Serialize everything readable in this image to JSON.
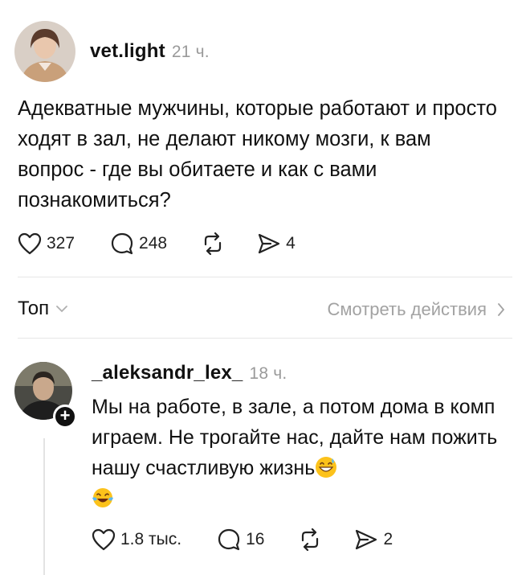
{
  "post": {
    "author": "vet.light",
    "time": "21 ч.",
    "text": "Адекватные мужчины, которые работают и просто ходят в зал, не делают никому мозги, к вам вопрос - где вы обитаете и как с вами познакомиться?",
    "likes": "327",
    "comments": "248",
    "shares": "4"
  },
  "sort": {
    "label": "Топ",
    "see_actions": "Смотреть действия"
  },
  "reply": {
    "author": "_aleksandr_lex_",
    "time": "18 ч.",
    "text": "Мы на работе, в зале, а потом дома в комп играем. Не трогайте нас, дайте нам пожить нашу счастливую жизнь",
    "emojis": [
      "grinning-sweat-emoji",
      "tears-of-joy-emoji"
    ],
    "likes": "1.8 тыс.",
    "comments": "16",
    "shares": "2"
  }
}
